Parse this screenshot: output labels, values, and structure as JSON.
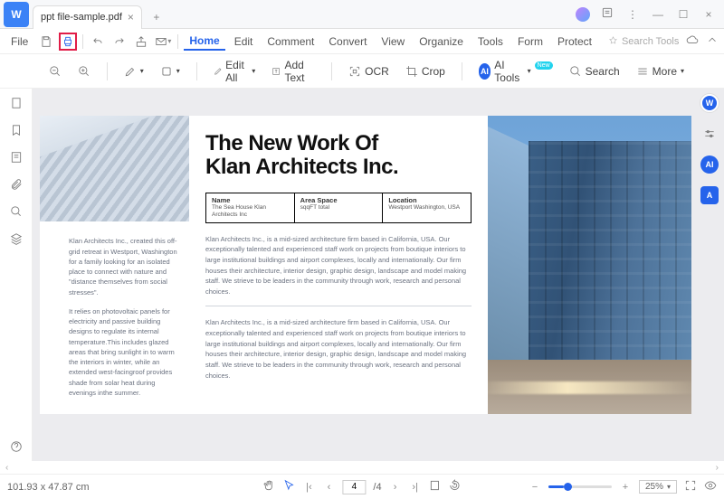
{
  "titlebar": {
    "app_glyph": "W",
    "tab_label": "ppt file-sample.pdf"
  },
  "menubar": {
    "file": "File",
    "home": "Home",
    "edit": "Edit",
    "comment": "Comment",
    "convert": "Convert",
    "view": "View",
    "organize": "Organize",
    "tools": "Tools",
    "form": "Form",
    "protect": "Protect",
    "search_tools": "Search Tools"
  },
  "toolbar": {
    "edit_all": "Edit All",
    "add_text": "Add Text",
    "ocr": "OCR",
    "crop": "Crop",
    "ai_tools": "AI Tools",
    "ai_badge": "New",
    "search": "Search",
    "more": "More"
  },
  "document": {
    "title_line1": "The New Work Of",
    "title_line2": "Klan Architects Inc.",
    "table": {
      "col1_h": "Name",
      "col1_v": "The Sea House Klan Architects Inc",
      "col2_h": "Area Space",
      "col2_v": "sqqFT total",
      "col3_h": "Location",
      "col3_v": "Westport Washington, USA"
    },
    "para1": "Klan Architects Inc., is a mid-sized architecture firm based in California, USA. Our exceptionally talented and experienced staff work on projects from boutique interiors to large institutional buildings and airport complexes, locally and internationally. Our firm houses their architecture, interior design, graphic design, landscape and model making staff. We strieve to be leaders in the community through work, research and personal choices.",
    "para2": "Klan Architects Inc., is a mid-sized architecture firm based in California, USA. Our exceptionally talented and experienced staff work on projects from boutique interiors to large institutional buildings and airport complexes, locally and internationally. Our firm houses their architecture, interior design, graphic design, landscape and model making staff. We strieve to be leaders in the community through work, research and personal choices.",
    "left_p1": "Klan Architects Inc., created this off-grid retreat in Westport, Washington for a family looking for an isolated place to connect with nature and \"distance themselves from social stresses\".",
    "left_p2": "It relies on photovoltaic panels for electricity and passive building designs to regulate its internal temperature.This includes glazed areas that bring sunlight in to warm the interiors in winter, while an extended west-facingroof provides shade from solar heat during evenings inthe summer."
  },
  "status": {
    "dimensions": "101.93 x 47.87 cm",
    "page_current": "4",
    "page_total": "/4",
    "zoom_pct": "25%"
  },
  "float": {
    "word": "W",
    "ai": "AI",
    "app": "A"
  }
}
